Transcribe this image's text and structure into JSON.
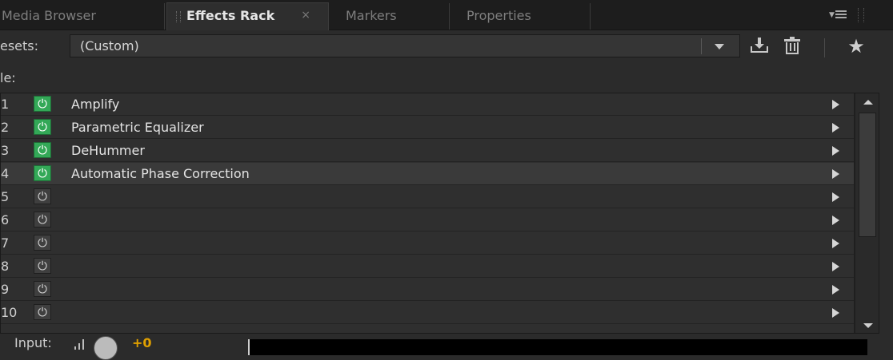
{
  "tabs": [
    {
      "label": "Media Browser",
      "active": false
    },
    {
      "label": "Effects Rack",
      "active": true,
      "close": "×"
    },
    {
      "label": "Markers",
      "active": false
    },
    {
      "label": "Properties",
      "active": false
    }
  ],
  "presets": {
    "label": "esets:",
    "value": "(Custom)",
    "save_icon": "save-preset-icon",
    "delete_icon": "trash-icon",
    "favorite_icon": "★"
  },
  "file_label": "le:",
  "slots": [
    {
      "num": "1",
      "on": true,
      "name": "Amplify"
    },
    {
      "num": "2",
      "on": true,
      "name": "Parametric Equalizer"
    },
    {
      "num": "3",
      "on": true,
      "name": "DeHummer"
    },
    {
      "num": "4",
      "on": true,
      "name": "Automatic Phase Correction"
    },
    {
      "num": "5",
      "on": false,
      "name": ""
    },
    {
      "num": "6",
      "on": false,
      "name": ""
    },
    {
      "num": "7",
      "on": false,
      "name": ""
    },
    {
      "num": "8",
      "on": false,
      "name": ""
    },
    {
      "num": "9",
      "on": false,
      "name": ""
    },
    {
      "num": "10",
      "on": false,
      "name": ""
    }
  ],
  "power_glyph": "⏻",
  "input": {
    "label": "Input:",
    "gain": "+0"
  },
  "colors": {
    "power_on": "#33a857",
    "gain_text": "#e0a000",
    "background": "#2b2b2b"
  }
}
